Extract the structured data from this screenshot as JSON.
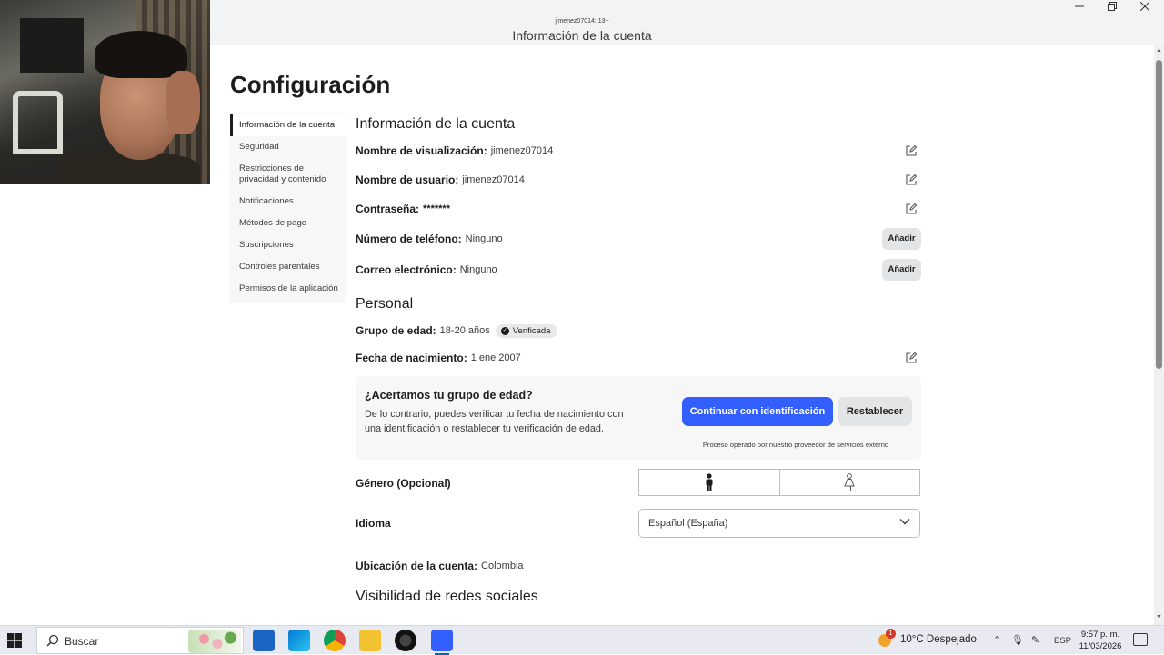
{
  "window": {
    "user_line": "jimenez07014: 13+",
    "title": "Información de la cuenta"
  },
  "page": {
    "title": "Configuración"
  },
  "sidenav": {
    "items": [
      {
        "label": "Información de la cuenta"
      },
      {
        "label": "Seguridad"
      },
      {
        "label": "Restricciones de privacidad y contenido"
      },
      {
        "label": "Notificaciones"
      },
      {
        "label": "Métodos de pago"
      },
      {
        "label": "Suscripciones"
      },
      {
        "label": "Controles parentales"
      },
      {
        "label": "Permisos de la aplicación"
      }
    ]
  },
  "account": {
    "heading": "Información de la cuenta",
    "display_name_label": "Nombre de visualización:",
    "display_name": "jimenez07014",
    "username_label": "Nombre de usuario:",
    "username": "jimenez07014",
    "password_label": "Contraseña:",
    "password": "*******",
    "phone_label": "Número de teléfono:",
    "phone": "Ninguno",
    "email_label": "Correo electrónico:",
    "email": "Ninguno",
    "add_label": "Añadir"
  },
  "personal": {
    "heading": "Personal",
    "age_group_label": "Grupo de edad:",
    "age_group": "18-20 años",
    "verified_badge": "Verificada",
    "birthdate_label": "Fecha de nacimiento:",
    "birthdate": "1 ene 2007",
    "age_check": {
      "question": "¿Acertamos tu grupo de edad?",
      "description": "De lo contrario, puedes verificar tu fecha de nacimiento con una identificación o restablecer tu verificación de edad.",
      "continue_label": "Continuar con identificación",
      "reset_label": "Restablecer",
      "note": "Proceso operado por nuestro proveedor de servicios externo"
    },
    "gender_label": "Género (Opcional)",
    "gender_options": [
      "male-icon",
      "female-icon"
    ],
    "language_label": "Idioma",
    "language_value": "Español (España)",
    "location_label": "Ubicación de la cuenta:",
    "location": "Colombia"
  },
  "social": {
    "heading": "Visibilidad de redes sociales"
  },
  "taskbar": {
    "search_placeholder": "Buscar",
    "weather": "10°C  Despejado",
    "weather_badge": "1",
    "lang": "ESP",
    "time": "9:57 p. m.",
    "date": "11/03/2026",
    "accent": "#335fff"
  }
}
